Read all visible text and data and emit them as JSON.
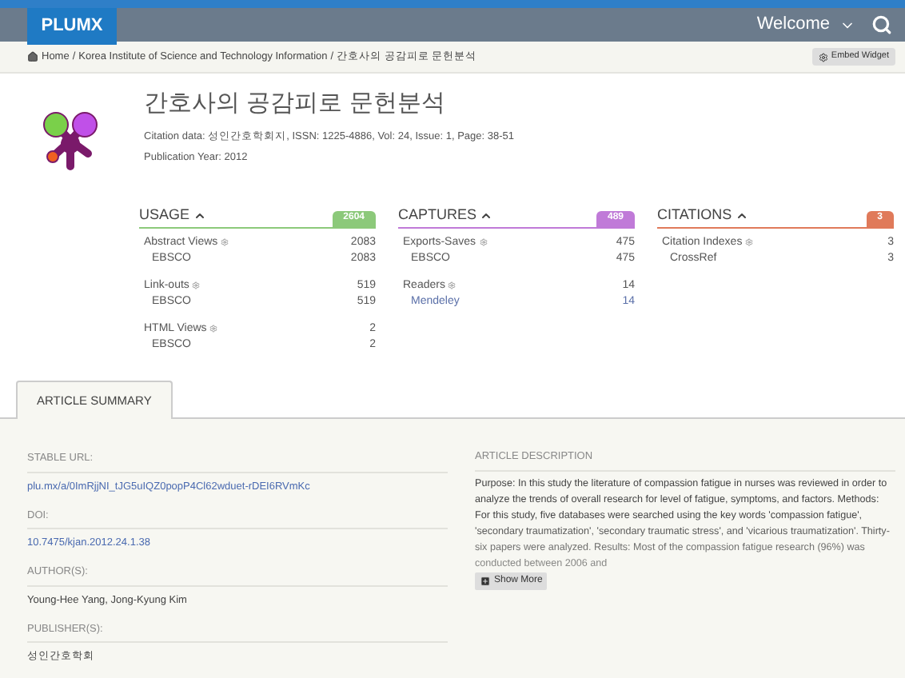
{
  "header": {
    "logo": "PLUMX",
    "welcome": "Welcome"
  },
  "breadcrumb": {
    "separator": "/",
    "items": [
      "Home",
      "Korea Institute of Science and Technology Information",
      "간호사의 공감피로 문헌분석"
    ],
    "embed_button": "Embed Widget"
  },
  "article": {
    "title": "간호사의 공감피로 문헌분석",
    "citation": "Citation data: 성인간호학회지, ISSN: 1225-4886, Vol: 24, Issue: 1, Page: 38-51",
    "year": "Publication Year: 2012"
  },
  "metrics": [
    {
      "title": "USAGE",
      "count": "2604",
      "color": "#8cc97a",
      "rows": [
        {
          "kind": "metric",
          "label": "Abstract Views",
          "value": "2083",
          "link": false
        },
        {
          "kind": "source",
          "label": "EBSCO",
          "value": "2083",
          "link": false
        },
        {
          "kind": "metric",
          "label": "Link-outs",
          "value": "519",
          "link": false
        },
        {
          "kind": "source",
          "label": "EBSCO",
          "value": "519",
          "link": false
        },
        {
          "kind": "metric",
          "label": "HTML Views",
          "value": "2",
          "link": false
        },
        {
          "kind": "source",
          "label": "EBSCO",
          "value": "2",
          "link": false
        }
      ]
    },
    {
      "title": "CAPTURES",
      "count": "489",
      "color": "#c07ad8",
      "rows": [
        {
          "kind": "metric",
          "label": "Exports-Saves",
          "value": "475",
          "link": false
        },
        {
          "kind": "source",
          "label": "EBSCO",
          "value": "475",
          "link": false
        },
        {
          "kind": "metric",
          "label": "Readers",
          "value": "14",
          "link": false
        },
        {
          "kind": "source",
          "label": "Mendeley",
          "value": "14",
          "link": true
        }
      ]
    },
    {
      "title": "CITATIONS",
      "count": "3",
      "color": "#e07a5a",
      "rows": [
        {
          "kind": "metric",
          "label": "Citation Indexes",
          "value": "3",
          "link": false
        },
        {
          "kind": "source",
          "label": "CrossRef",
          "value": "3",
          "link": false
        }
      ]
    }
  ],
  "tabs": [
    {
      "label": "ARTICLE SUMMARY",
      "selected": true
    }
  ],
  "summary": [
    {
      "label": "STABLE URL:",
      "value": "plu.mx/a/0ImRjjNI_tJG5uIQZ0popP4Cl62wduet-rDEI6RVmKc",
      "link": true
    },
    {
      "label": "DOI:",
      "value": "10.7475/kjan.2012.24.1.38",
      "link": true
    },
    {
      "label": "AUTHOR(S):",
      "value": "Young-Hee Yang, Jong-Kyung Kim",
      "link": false
    },
    {
      "label": "PUBLISHER(S):",
      "value": "성인간호학회",
      "link": false
    }
  ],
  "description": {
    "label": "ARTICLE DESCRIPTION",
    "text": "Purpose: In this study the literature of compassion fatigue in nurses was reviewed in order to analyze the trends of overall research for level of fatigue, symptoms, and factors. Methods: For this study, five databases were searched using the key words 'compassion fatigue', 'secondary traumatization', 'secondary traumatic stress', and 'vicarious traumatization'. Thirty-six papers were analyzed. Results: Most of the compassion fatigue research (96%) was conducted between 2006 and",
    "button": "Show More"
  }
}
